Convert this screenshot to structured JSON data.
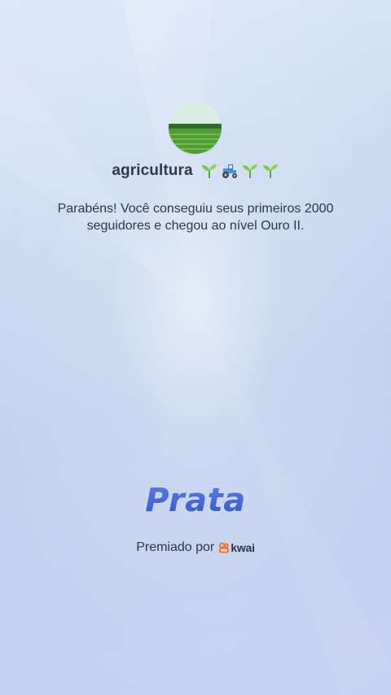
{
  "profile": {
    "avatar_icon": "farm-field-avatar",
    "username": "agricultura",
    "username_emojis": [
      "seedling-icon",
      "tractor-icon",
      "seedling-icon",
      "seedling-icon"
    ]
  },
  "message": "Parabéns! Você conseguiu seus primeiros 2000 seguidores e chegou ao nível Ouro II.",
  "level": {
    "title": "Prata",
    "color": "#3d5fcc"
  },
  "awarded": {
    "label": "Premiado por",
    "brand": "kwai",
    "brand_color": "#ff6a1a"
  }
}
